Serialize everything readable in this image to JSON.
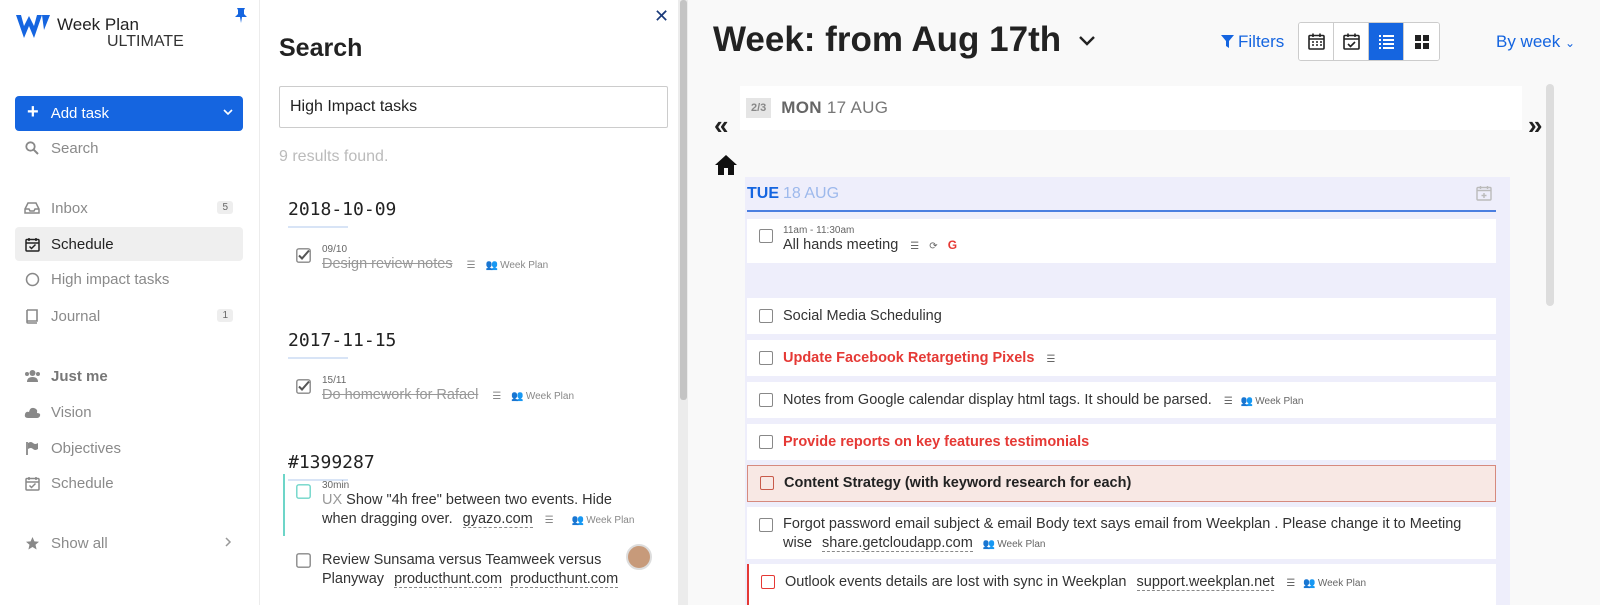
{
  "app": {
    "name": "Week Plan",
    "edition": "ULTIMATE"
  },
  "sidebar": {
    "add_task": "Add task",
    "search": "Search",
    "items": [
      {
        "label": "Inbox",
        "count": "5"
      },
      {
        "label": "Schedule"
      },
      {
        "label": "High impact tasks"
      },
      {
        "label": "Journal",
        "count": "1"
      }
    ],
    "section": "Just me",
    "section_items": [
      {
        "label": "Vision"
      },
      {
        "label": "Objectives"
      },
      {
        "label": "Schedule"
      }
    ],
    "show_all": "Show all"
  },
  "search_panel": {
    "title": "Search",
    "query": "High Impact tasks",
    "results_text": "9 results found.",
    "groups": [
      {
        "heading": "2018-10-09",
        "items": [
          {
            "meta": "09/10",
            "text": "Design review notes",
            "tag": "Week Plan"
          }
        ]
      },
      {
        "heading": "2017-11-15",
        "items": [
          {
            "meta": "15/11",
            "text": "Do homework for Rafael",
            "tag": "Week Plan"
          }
        ]
      },
      {
        "heading": "#1399287",
        "items": [
          {
            "meta": "30min",
            "prefix": "UX",
            "text1": "Show \"4h free\" between two events. Hide",
            "text2": "when dragging over.",
            "link": "gyazo.com",
            "tag": "Week Plan"
          },
          {
            "text1": "Review Sunsama versus Teamweek versus",
            "text2": "Planyway",
            "link1": "producthunt.com",
            "link2": "producthunt.com"
          }
        ]
      }
    ]
  },
  "calendar": {
    "title": "Week: from Aug 17th",
    "filters": "Filters",
    "by_week": "By week",
    "monday": {
      "badge": "2/3",
      "day": "MON",
      "date": "17 AUG"
    },
    "tuesday": {
      "day": "TUE",
      "date": "18 AUG"
    },
    "tasks": [
      {
        "time": "11am - 11:30am",
        "text": "All hands meeting",
        "g": "G"
      },
      {
        "text": "Social Media Scheduling"
      },
      {
        "text": "Update Facebook Retargeting Pixels"
      },
      {
        "text": "Notes from Google calendar display html tags. It should be parsed.",
        "tag": "Week Plan"
      },
      {
        "text": "Provide reports on key features testimonials"
      },
      {
        "text": "Content Strategy (with keyword research for each)"
      },
      {
        "text1": "Forgot password email subject & email Body text says email from Weekplan . Please change it to Meeting",
        "text2": "wise",
        "link": "share.getcloudapp.com",
        "tag": "Week Plan"
      },
      {
        "text": "Outlook events details are lost with sync in Weekplan",
        "link": "support.weekplan.net",
        "tag": "Week Plan"
      }
    ]
  },
  "colors": {
    "accent": "#1565e0",
    "danger": "#e53935",
    "teal": "#6dd5c8"
  }
}
